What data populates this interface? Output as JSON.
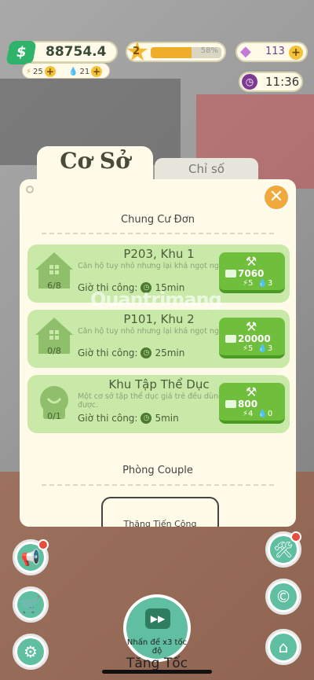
{
  "hud": {
    "cash": "88754.4",
    "energy": "25",
    "water": "21",
    "level": "2",
    "level_percent": "58%",
    "level_progress": 0.58,
    "gems": "113",
    "time": "11:36"
  },
  "tabs": {
    "active": "Cơ Sở",
    "inactive": "Chỉ số"
  },
  "panel": {
    "section1_title": "Chung Cư Đơn",
    "section2_title": "Phòng Couple",
    "build_time_label": "Giờ thi công:",
    "cards": [
      {
        "title": "P203, Khu 1",
        "desc": "Căn hộ tuy nhỏ nhưng lại khá ngọt ngào.",
        "count": "6/8",
        "time": "15min",
        "cost": "7060",
        "cost_energy": "5",
        "cost_water": "3"
      },
      {
        "title": "P101, Khu 2",
        "desc": "Căn hộ tuy nhỏ nhưng lại khá ngọt ngào.",
        "count": "0/8",
        "time": "25min",
        "cost": "20000",
        "cost_energy": "5",
        "cost_water": "3"
      },
      {
        "title": "Khu Tập Thể Dục",
        "desc": "Một cơ sở tập thể dục giá trẻ đều dùng được.",
        "count": "0/1",
        "time": "5min",
        "cost": "800",
        "cost_energy": "4",
        "cost_water": "0"
      }
    ],
    "partial_card_label": "Thăng Tiến Công"
  },
  "watermark": "Quantrimang",
  "speed": {
    "text": "Nhấn để x3 tốc độ",
    "label": "Tăng Tốc"
  },
  "colors": {
    "card_green": "#c8e9a7",
    "button_green": "#6fbf3c",
    "panel_bg": "#fffbe8",
    "close_orange": "#f2a93b"
  }
}
